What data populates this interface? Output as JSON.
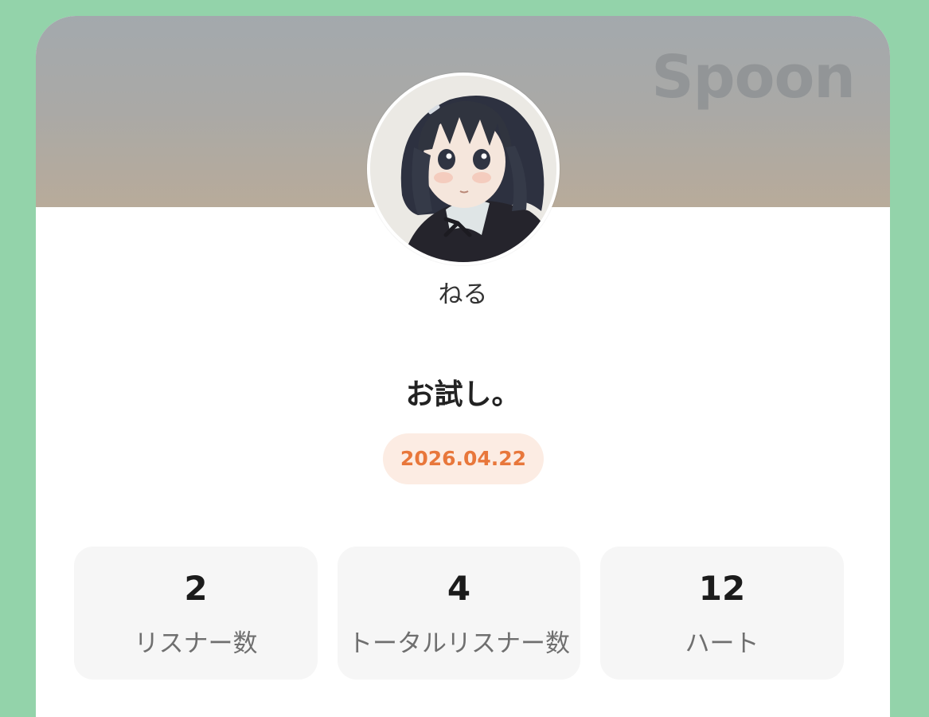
{
  "brand": {
    "logo_text": "Spoon"
  },
  "profile": {
    "nickname": "ねる"
  },
  "broadcast": {
    "title": "お試し。",
    "date": "2026.04.22"
  },
  "stats": [
    {
      "value": "2",
      "label": "リスナー数"
    },
    {
      "value": "4",
      "label": "トータルリスナー数"
    },
    {
      "value": "12",
      "label": "ハート"
    }
  ],
  "colors": {
    "background": "#93d3aa",
    "accent": "#e8773b",
    "date_pill": "#fcece3"
  }
}
